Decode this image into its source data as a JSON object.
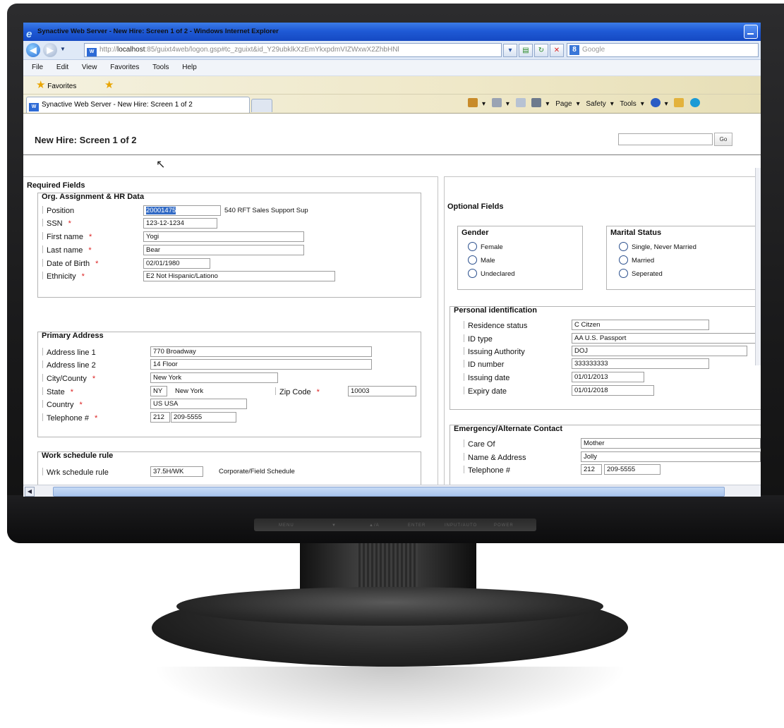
{
  "window": {
    "title": "Synactive Web Server - New Hire: Screen 1 of 2 - Windows Internet Explorer"
  },
  "browser": {
    "url_prefix": "http://",
    "url_host": "localhost",
    "url_rest": ":85/guixt4web/logon.gsp#tc_zguixt&id_Y29ubklkXzEmYkxpdmVIZWxwX2ZhbHNl",
    "search_placeholder": "Google",
    "menu": [
      "File",
      "Edit",
      "View",
      "Favorites",
      "Tools",
      "Help"
    ],
    "favorites_label": "Favorites",
    "tab_title": "Synactive Web Server - New Hire: Screen 1 of 2",
    "commands": [
      "Page",
      "Safety",
      "Tools"
    ]
  },
  "page": {
    "title": "New Hire: Screen 1 of 2",
    "go_label": "Go",
    "required_header": "Required Fields",
    "optional_header": "Optional Fields"
  },
  "org": {
    "title": "Org. Assignment & HR Data",
    "position_label": "Position",
    "position_value": "20001475",
    "position_desc": "540 RFT Sales Support Sup",
    "ssn_label": "SSN",
    "ssn_value": "123-12-1234",
    "first_label": "First name",
    "first_value": "Yogi",
    "last_label": "Last name",
    "last_value": "Bear",
    "dob_label": "Date of Birth",
    "dob_value": "02/01/1980",
    "eth_label": "Ethnicity",
    "eth_value": "E2 Not Hispanic/Lationo"
  },
  "address": {
    "title": "Primary Address",
    "line1_label": "Address line 1",
    "line1_value": "770 Broadway",
    "line2_label": "Address line 2",
    "line2_value": "14 Floor",
    "city_label": "City/County",
    "city_value": "New York",
    "state_label": "State",
    "state_code": "NY",
    "state_name": "New York",
    "zip_label": "Zip Code",
    "zip_value": "10003",
    "country_label": "Country",
    "country_value": "US USA",
    "tel_label": "Telephone #",
    "tel_area": "212",
    "tel_number": "209-5555"
  },
  "work": {
    "title": "Work schedule rule",
    "label": "Wrk schedule rule",
    "value": "37.5H/WK",
    "desc": "Corporate/Field Schedule"
  },
  "gender": {
    "title": "Gender",
    "options": [
      "Female",
      "Male",
      "Undeclared"
    ]
  },
  "marital": {
    "title": "Marital Status",
    "options": [
      "Single, Never Married",
      "Married",
      "Seperated"
    ]
  },
  "personal": {
    "title": "Personal identification",
    "res_label": "Residence status",
    "res_value": "C Citzen",
    "idtype_label": "ID type",
    "idtype_value": "AA U.S. Passport",
    "auth_label": "Issuing Authority",
    "auth_value": "DOJ",
    "idnum_label": "ID number",
    "idnum_value": "333333333",
    "issue_label": "Issuing date",
    "issue_value": "01/01/2013",
    "expiry_label": "Expiry date",
    "expiry_value": "01/01/2018"
  },
  "emergency": {
    "title": "Emergency/Alternate Contact",
    "careof_label": "Care Of",
    "careof_value": "Mother",
    "name_label": "Name & Address",
    "name_value": "Jolly",
    "tel_label": "Telephone #",
    "tel_area": "212",
    "tel_number": "209-5555"
  },
  "monitor": {
    "buttons": [
      "MENU",
      "▼",
      "▲/A",
      "ENTER",
      "INPUT/AUTO",
      "POWER"
    ]
  },
  "colors": {
    "titlebar": "#1f5ad6",
    "required_marker": "#dd2222",
    "selection": "#316ac5"
  }
}
